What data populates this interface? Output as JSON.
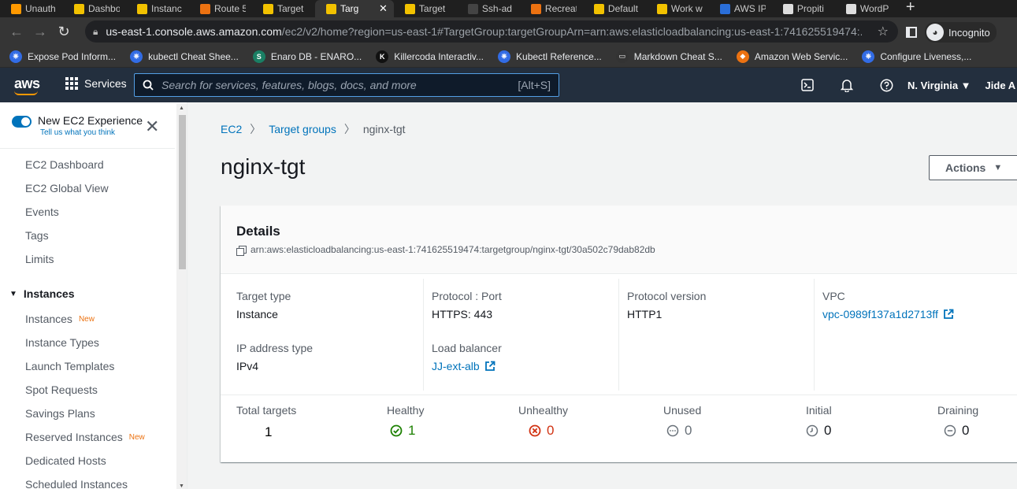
{
  "browser": {
    "tabs": [
      {
        "label": "Unauth",
        "color": "#ff9900"
      },
      {
        "label": "Dashbo",
        "color": "#f2c200"
      },
      {
        "label": "Instanc",
        "color": "#f2c200"
      },
      {
        "label": "Route 5",
        "color": "#ec7211"
      },
      {
        "label": "Target",
        "color": "#f2c200"
      },
      {
        "label": "Targ",
        "color": "#f2c200",
        "active": true
      },
      {
        "label": "Target",
        "color": "#f2c200"
      },
      {
        "label": "Ssh-ad",
        "color": "#444444"
      },
      {
        "label": "Recreat",
        "color": "#ec7211"
      },
      {
        "label": "Default",
        "color": "#f2c200"
      },
      {
        "label": "Work w",
        "color": "#f2c200"
      },
      {
        "label": "AWS IP",
        "color": "#2a6ed8"
      },
      {
        "label": "Propiti",
        "color": "#dddddd"
      },
      {
        "label": "WordP",
        "color": "#dddddd"
      }
    ],
    "url_host": "us-east-1.console.aws.amazon.com",
    "url_path": "/ec2/v2/home?region=us-east-1#TargetGroup:targetGroupArn=arn:aws:elasticloadbalancing:us-east-1:741625519474:...",
    "incognito_label": "Incognito",
    "bookmarks": [
      {
        "label": "Expose Pod Inform...",
        "color": "#326ce5",
        "glyph": "⎈"
      },
      {
        "label": "kubectl Cheat Shee...",
        "color": "#326ce5",
        "glyph": "⎈"
      },
      {
        "label": "Enaro DB - ENARO...",
        "color": "#1a7f64",
        "glyph": "S"
      },
      {
        "label": "Killercoda Interactiv...",
        "color": "#111111",
        "glyph": "K"
      },
      {
        "label": "Kubectl Reference...",
        "color": "#326ce5",
        "glyph": "⎈"
      },
      {
        "label": "Markdown Cheat S...",
        "color": "#333333",
        "glyph": "▭"
      },
      {
        "label": "Amazon Web Servic...",
        "color": "#ec7211",
        "glyph": "◆"
      },
      {
        "label": "Configure Liveness,...",
        "color": "#326ce5",
        "glyph": "⎈"
      }
    ]
  },
  "aws": {
    "logo": "aws",
    "services_label": "Services",
    "search_placeholder": "Search for services, features, blogs, docs, and more",
    "search_shortcut": "[Alt+S]",
    "region": "N. Virginia ▼",
    "user": "Jide A"
  },
  "sidebar": {
    "new_experience": "New EC2 Experience",
    "tell_us": "Tell us what you think",
    "top_items": [
      "EC2 Dashboard",
      "EC2 Global View",
      "Events",
      "Tags",
      "Limits"
    ],
    "section": "Instances",
    "section_items": [
      {
        "label": "Instances",
        "tag": "New"
      },
      {
        "label": "Instance Types",
        "tag": ""
      },
      {
        "label": "Launch Templates",
        "tag": ""
      },
      {
        "label": "Spot Requests",
        "tag": ""
      },
      {
        "label": "Savings Plans",
        "tag": ""
      },
      {
        "label": "Reserved Instances",
        "tag": "New"
      },
      {
        "label": "Dedicated Hosts",
        "tag": ""
      },
      {
        "label": "Scheduled Instances",
        "tag": ""
      }
    ]
  },
  "main": {
    "breadcrumb": [
      "EC2",
      "Target groups",
      "nginx-tgt"
    ],
    "title": "nginx-tgt",
    "actions_label": "Actions",
    "details": {
      "heading": "Details",
      "arn": "arn:aws:elasticloadbalancing:us-east-1:741625519474:targetgroup/nginx-tgt/30a502c79dab82db",
      "target_type_label": "Target type",
      "target_type": "Instance",
      "ip_type_label": "IP address type",
      "ip_type": "IPv4",
      "protocol_label": "Protocol : Port",
      "protocol": "HTTPS: 443",
      "lb_label": "Load balancer",
      "lb": "JJ-ext-alb",
      "proto_version_label": "Protocol version",
      "proto_version": "HTTP1",
      "vpc_label": "VPC",
      "vpc": "vpc-0989f137a1d2713ff"
    },
    "stats": {
      "total_label": "Total targets",
      "total": "1",
      "healthy_label": "Healthy",
      "healthy": "1",
      "unhealthy_label": "Unhealthy",
      "unhealthy": "0",
      "unused_label": "Unused",
      "unused": "0",
      "initial_label": "Initial",
      "initial": "0",
      "draining_label": "Draining",
      "draining": "0"
    }
  }
}
